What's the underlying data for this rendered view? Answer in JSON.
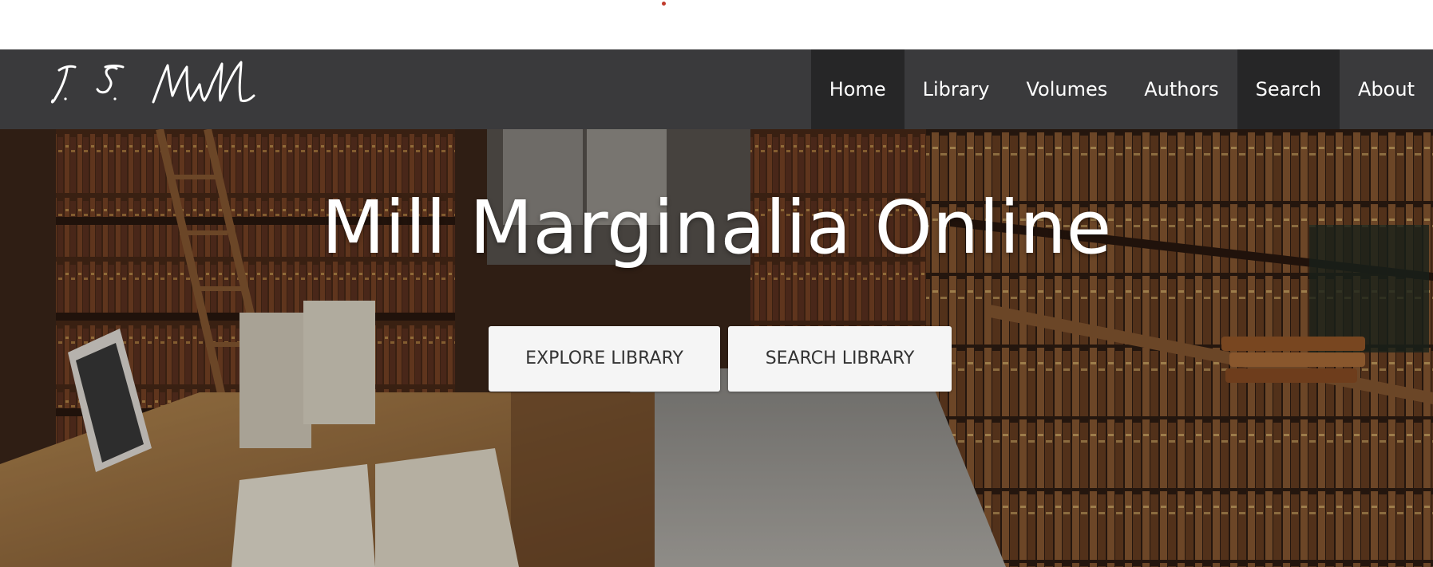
{
  "brand": {
    "signature": "J. S. Mill"
  },
  "nav": {
    "items": [
      {
        "label": "Home",
        "active": true
      },
      {
        "label": "Library",
        "active": false
      },
      {
        "label": "Volumes",
        "active": false
      },
      {
        "label": "Authors",
        "active": false
      },
      {
        "label": "Search",
        "active": true
      },
      {
        "label": "About",
        "active": false
      }
    ]
  },
  "hero": {
    "title": "Mill Marginalia Online",
    "buttons": {
      "explore_label": "EXPLORE LIBRARY",
      "search_label": "SEARCH LIBRARY"
    }
  },
  "colors": {
    "navbar": "#3a3a3c",
    "nav_active": "#262627",
    "button_bg": "#f5f5f5",
    "button_text": "#333333"
  }
}
